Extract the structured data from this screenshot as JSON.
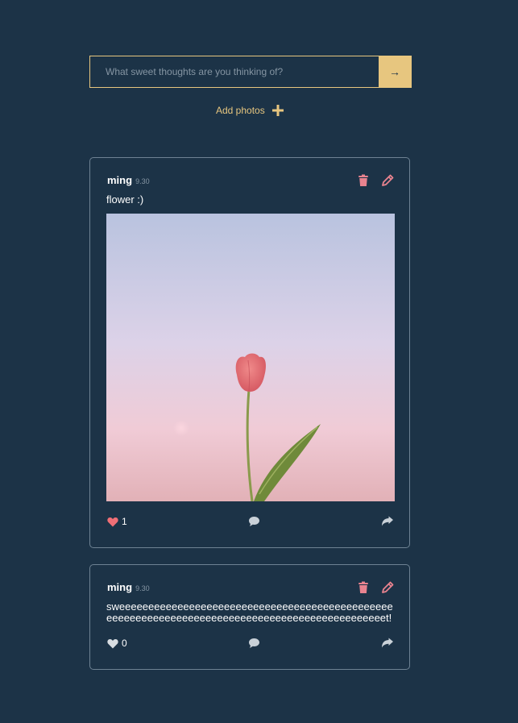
{
  "composer": {
    "placeholder": "What sweet thoughts are you thinking of?",
    "submit_label": "→",
    "add_photos_label": "Add photos"
  },
  "posts": [
    {
      "author": "ming",
      "time": "9.30",
      "text": "flower :)",
      "has_image": true,
      "image_alt": "tulip-photo",
      "likes": "1",
      "liked": true
    },
    {
      "author": "ming",
      "time": "9.30",
      "text": "sweeeeeeeeeeeeeeeeeeeeeeeeeeeeeeeeeeeeeeeeeeeeeeeeeeeeeeeeeeeeeeeeeeeeeeeeeeeeeeeeeeeeeeeeeeeeeeet!",
      "has_image": false,
      "likes": "0",
      "liked": false
    }
  ],
  "colors": {
    "background": "#1c3347",
    "accent": "#e7c67f",
    "action_pink": "#e8838f",
    "like_red": "#ef6f76",
    "icon_gray": "#c9d1d8",
    "border": "#6e8293"
  }
}
